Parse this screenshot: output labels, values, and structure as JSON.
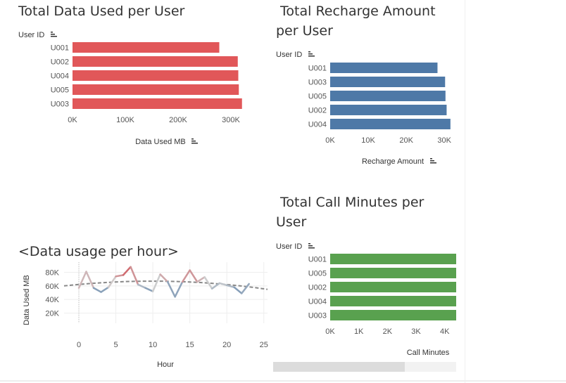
{
  "colors": {
    "data_bar": "#e15759",
    "recharge_bar": "#4e79a7",
    "call_bar": "#59a14f",
    "line_high": "#d0595f",
    "line_low": "#4e79a7",
    "trend": "#888888",
    "gridline": "#eeeeee"
  },
  "icons": {
    "sort": "sort-icon"
  },
  "chart_data": [
    {
      "id": "data_used",
      "type": "bar",
      "orientation": "horizontal",
      "title": "Total Data Used per User",
      "ylabel": "User ID",
      "xlabel": "Data Used MB",
      "categories": [
        "U001",
        "U002",
        "U004",
        "U005",
        "U003"
      ],
      "values": [
        278000,
        313000,
        314000,
        315000,
        321000
      ],
      "xlim": [
        0,
        320000
      ],
      "xticks": [
        0,
        100000,
        200000,
        300000
      ],
      "xtick_labels": [
        "0K",
        "100K",
        "200K",
        "300K"
      ],
      "grid": false
    },
    {
      "id": "recharge",
      "type": "bar",
      "orientation": "horizontal",
      "title": "Total Recharge Amount per User",
      "title_lines": [
        " Total Recharge Amount",
        "per User"
      ],
      "ylabel": "User ID",
      "xlabel": "Recharge Amount",
      "categories": [
        "U001",
        "U003",
        "U005",
        "U002",
        "U004"
      ],
      "values": [
        28200,
        30200,
        30300,
        30600,
        31600
      ],
      "xlim": [
        0,
        32000
      ],
      "xticks": [
        0,
        10000,
        20000,
        30000
      ],
      "xtick_labels": [
        "0K",
        "10K",
        "20K",
        "30K"
      ],
      "grid": false
    },
    {
      "id": "call_minutes",
      "type": "bar",
      "orientation": "horizontal",
      "title": "Total Call Minutes per User",
      "title_lines": [
        " Total Call Minutes per",
        "User"
      ],
      "ylabel": "User ID",
      "xlabel": "Call Minutes",
      "categories": [
        "U001",
        "U005",
        "U002",
        "U004",
        "U003"
      ],
      "values": [
        4400,
        4400,
        4400,
        4400,
        4400
      ],
      "xlim": [
        0,
        4400
      ],
      "xticks": [
        0,
        1000,
        2000,
        3000,
        4000
      ],
      "xtick_labels": [
        "0K",
        "1K",
        "2K",
        "3K",
        "4K"
      ],
      "grid": false
    },
    {
      "id": "hourly",
      "type": "line",
      "title": "<Data usage per hour>",
      "xlabel": "Hour",
      "ylabel": "Data Used MB",
      "x": [
        0,
        1,
        2,
        3,
        4,
        5,
        6,
        7,
        8,
        9,
        10,
        11,
        12,
        13,
        14,
        15,
        16,
        17,
        18,
        19,
        20,
        21,
        22,
        23
      ],
      "y": [
        57000,
        81000,
        57000,
        51000,
        58000,
        74000,
        76000,
        88000,
        62000,
        57000,
        52000,
        77000,
        66000,
        44000,
        66000,
        83000,
        66000,
        73000,
        56000,
        64000,
        61000,
        58000,
        49000,
        63000
      ],
      "trend": {
        "x": [
          -2,
          25.5
        ],
        "y": [
          60000,
          55000
        ],
        "peak_x": 10,
        "peak_y": 67000,
        "style": "dashed"
      },
      "xlim": [
        -2,
        25.5
      ],
      "ylim": [
        0,
        90000
      ],
      "xticks": [
        0,
        5,
        10,
        15,
        20,
        25
      ],
      "yticks": [
        20000,
        40000,
        60000,
        80000
      ],
      "ytick_labels": [
        "20K",
        "40K",
        "60K",
        "80K"
      ],
      "grid": true
    }
  ],
  "scrollbar": {
    "position": 0.72
  }
}
